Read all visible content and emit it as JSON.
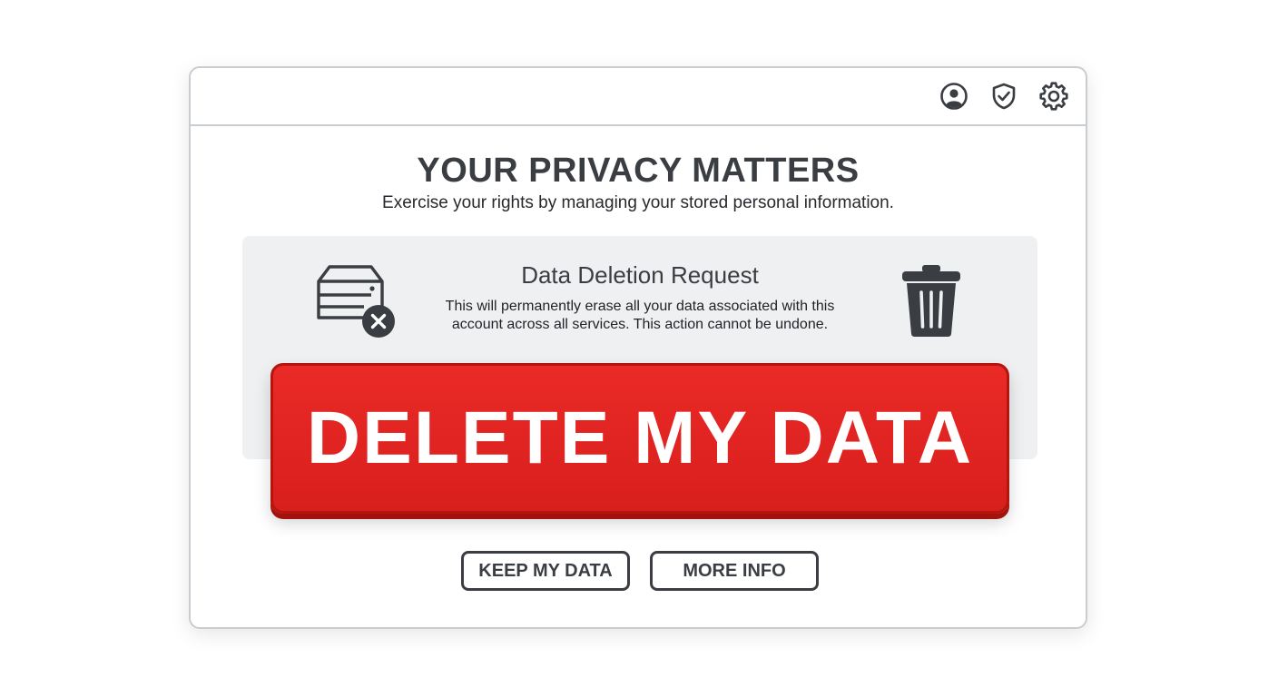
{
  "header": {
    "icons": [
      "user-icon",
      "shield-check-icon",
      "gear-icon"
    ]
  },
  "main": {
    "title": "YOUR PRIVACY MATTERS",
    "subtitle": "Exercise your rights by managing your stored personal information."
  },
  "panel": {
    "title": "Data Deletion Request",
    "description": "This will permanently erase all your data associated with this account across all services. This action cannot be undone.",
    "left_icon": "server-delete-icon",
    "right_icon": "trash-icon"
  },
  "actions": {
    "delete_label": "DELETE MY DATA",
    "keep_label": "KEEP MY DATA",
    "info_label": "MORE INFO"
  },
  "colors": {
    "danger": "#e12623",
    "text_dark": "#3a3d42",
    "panel_bg": "#eff0f2",
    "border": "#c9ccd0"
  }
}
